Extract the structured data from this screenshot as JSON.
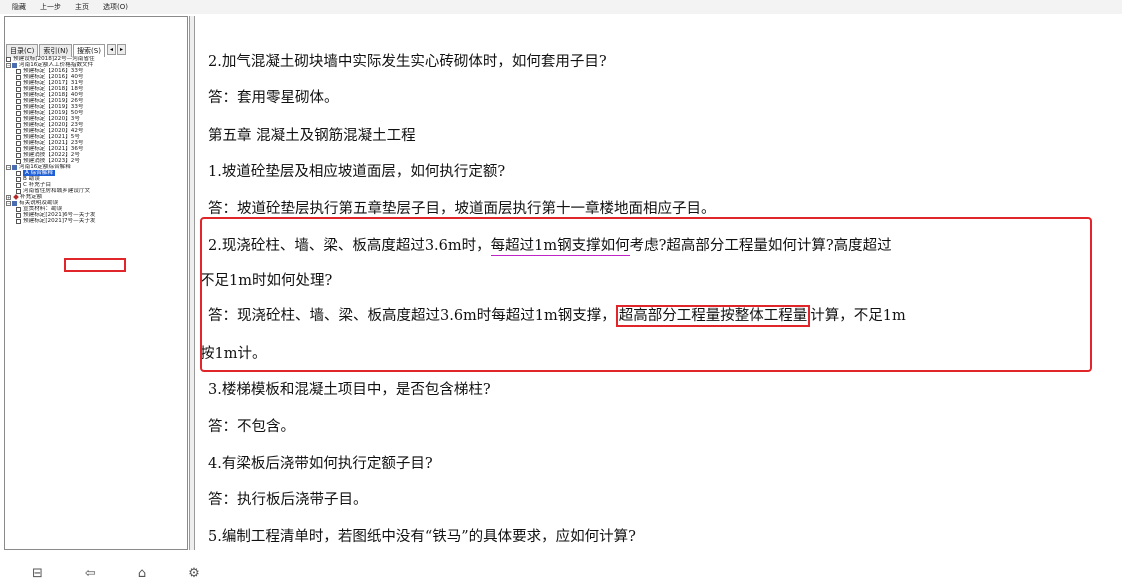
{
  "toolbar": {
    "hide": "隐藏",
    "back": "上一步",
    "home": "主页",
    "options": "选项(O)"
  },
  "left_tabs": {
    "contents": "目录(C)",
    "index": "索引(N)",
    "search": "搜索(S)",
    "prev": "◂",
    "next": "▸"
  },
  "tree": [
    "预建设标[2018]22号—河南省住",
    "河南16定额人工价格指数文件",
    "预建标定【2016】33号",
    "预建标定【2016】40号",
    "预建标定【2017】31号",
    "预建标定【2018】18号",
    "预建标定【2018】40号",
    "预建标定【2019】26号",
    "预建标定【2019】33号",
    "预建标定【2019】50号",
    "预建标定【2020】3号",
    "预建标定【2020】23号",
    "预建标定【2020】42号",
    "预建标定【2021】5号",
    "预建标定【2021】23号",
    "预建标定【2021】36号",
    "预建消技【2022】2号",
    "预建消技【2023】2号",
    "河南16定额综合解释",
    "A 综合解释",
    "B 勘误",
    "C 补充子目",
    "河南省住房和城乡建设厅文",
    "补充定额",
    "有关说明及勘误",
    "宣贯材料：勘误",
    "预建标定[2021]6号—关于发",
    "预建标定[2021]7号—关于发"
  ],
  "content": {
    "p1": "2.加气混凝土砌块墙中实际发生实心砖砌体时，如何套用子目?",
    "p2": "答：套用零星砌体。",
    "p3": "第五章 混凝土及钢筋混凝土工程",
    "p4": "1.坡道砼垫层及相应坡道面层，如何执行定额?",
    "p5": "答：坡道砼垫层执行第五章垫层子目，坡道面层执行第十一章楼地面相应子目。",
    "p6_a": "2.现浇砼柱、墙、梁、板高度超过3.6m时，",
    "p6_b": "每超过1m钢支撑如何",
    "p6_c": "考虑?超高部分工程量如何计算?高度超过",
    "p7": "不足1m时如何处理?",
    "p8_a": "答：现浇砼柱、墙、梁、板高度超过3.6m时每超过1m钢支撑，",
    "p8_b": "超高部分工程量按整体工程量",
    "p8_c": "计算，不足1m",
    "p9": "按1m计。",
    "p10": "3.楼梯模板和混凝土项目中，是否包含梯柱?",
    "p11": "答：不包含。",
    "p12": "4.有梁板后浇带如何执行定额子目?",
    "p13": "答：执行板后浇带子目。",
    "p14": "5.编制工程清单时，若图纸中没有“铁马”的具体要求，应如何计算?"
  },
  "bottombar": {
    "hide_icon": "⊟",
    "back_icon": "⇦",
    "home_icon": "⌂",
    "options_icon": "⚙"
  }
}
